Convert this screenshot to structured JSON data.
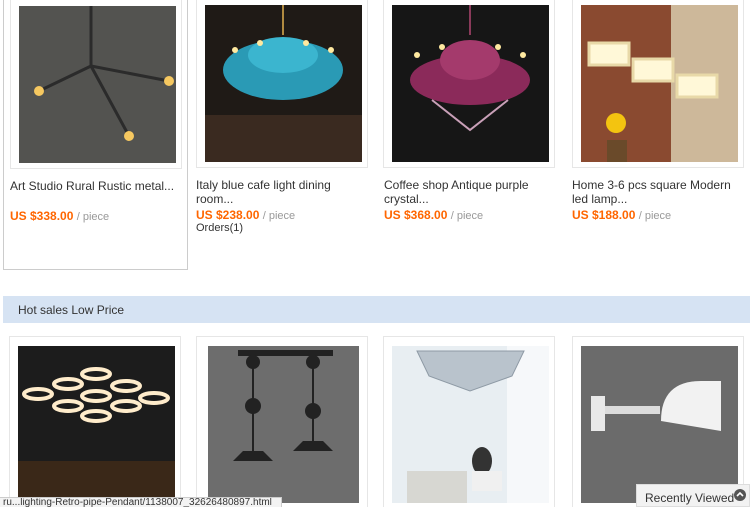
{
  "top_products": [
    {
      "title": "Art Studio Rural Rustic metal...",
      "price": "US $338.00",
      "unit": "/ piece",
      "orders": ""
    },
    {
      "title": "Italy blue cafe light dining room...",
      "price": "US $238.00",
      "unit": "/ piece",
      "orders": "Orders(1)"
    },
    {
      "title": "Coffee shop Antique purple crystal...",
      "price": "US $368.00",
      "unit": "/ piece",
      "orders": ""
    },
    {
      "title": "Home 3-6 pcs square Modern led lamp...",
      "price": "US $188.00",
      "unit": "/ piece",
      "orders": ""
    }
  ],
  "section": {
    "title": "Hot sales Low Price"
  },
  "bottom_products": [
    {
      "image": "ring-led-chandelier"
    },
    {
      "image": "pulley-pendant-lamp"
    },
    {
      "image": "crystal-ceiling-lamp"
    },
    {
      "image": "white-wall-lamp"
    }
  ],
  "status_url": "ru...lighting-Retro-pipe-Pendant/1138007_32626480897.html",
  "recently_viewed": {
    "label": "Recently Viewed"
  },
  "colors": {
    "price": "#ff6600",
    "banner": "#d6e3f3"
  }
}
